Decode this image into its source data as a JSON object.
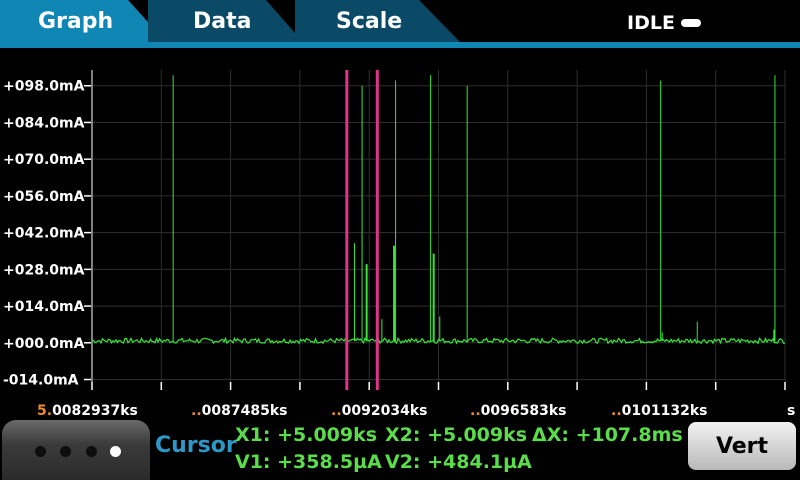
{
  "tabs": [
    {
      "label": "Graph",
      "active": true
    },
    {
      "label": "Data",
      "active": false
    },
    {
      "label": "Scale",
      "active": false
    }
  ],
  "status": {
    "label": "IDLE",
    "icon": "idle-indicator-icon"
  },
  "chart_data": {
    "type": "line",
    "y_unit": "mA",
    "y_ticks": [
      "+098.0mA",
      "+084.0mA",
      "+070.0mA",
      "+056.0mA",
      "+042.0mA",
      "+028.0mA",
      "+014.0mA",
      "+000.0mA",
      "-014.0mA"
    ],
    "y_tick_values": [
      98,
      84,
      70,
      56,
      42,
      28,
      14,
      0,
      -14
    ],
    "ylim": [
      -18,
      104
    ],
    "x_ticks": [
      {
        "prefix": "5.",
        "label": "0082937ks"
      },
      {
        "prefix": "..",
        "label": "0087485ks"
      },
      {
        "prefix": "..",
        "label": "0092034ks"
      },
      {
        "prefix": "..",
        "label": "0096583ks"
      },
      {
        "prefix": "..",
        "label": "0101132ks"
      }
    ],
    "x_unit": "s",
    "x_range_ks": [
      5.0082937,
      5.010568
    ],
    "series": [
      {
        "color": "#39e639",
        "baseline_mA": 0.6,
        "spikes": [
          {
            "x_ks": 5.00856,
            "y_mA": 102,
            "width": 1
          },
          {
            "x_ks": 5.009155,
            "y_mA": 38,
            "width": 1
          },
          {
            "x_ks": 5.00918,
            "y_mA": 98,
            "width": 1
          },
          {
            "x_ks": 5.009195,
            "y_mA": 30,
            "width": 2
          },
          {
            "x_ks": 5.009245,
            "y_mA": 9,
            "width": 1
          },
          {
            "x_ks": 5.009285,
            "y_mA": 37,
            "width": 2
          },
          {
            "x_ks": 5.00929,
            "y_mA": 100,
            "width": 1
          },
          {
            "x_ks": 5.009405,
            "y_mA": 102,
            "width": 1
          },
          {
            "x_ks": 5.009415,
            "y_mA": 34,
            "width": 2
          },
          {
            "x_ks": 5.009435,
            "y_mA": 10,
            "width": 1
          },
          {
            "x_ks": 5.009525,
            "y_mA": 98,
            "width": 1
          },
          {
            "x_ks": 5.01016,
            "y_mA": 100,
            "width": 1
          },
          {
            "x_ks": 5.010165,
            "y_mA": 4,
            "width": 1
          },
          {
            "x_ks": 5.01028,
            "y_mA": 8,
            "width": 1
          },
          {
            "x_ks": 5.010535,
            "y_mA": 102,
            "width": 1
          },
          {
            "x_ks": 5.010533,
            "y_mA": 5,
            "width": 2
          }
        ]
      }
    ],
    "cursors": [
      {
        "name": "X1",
        "x_ks": 5.00913,
        "color": "#e0338a"
      },
      {
        "name": "X2",
        "x_ks": 5.00923,
        "color": "#e0338a"
      }
    ],
    "grid": true
  },
  "cursor": {
    "title": "Cursor",
    "x1": "X1: +5.009ks",
    "x2": "X2: +5.009ks",
    "dx": "ΔX: +107.8ms",
    "v1": "V1: +358.5µA",
    "v2": "V2: +484.1µA"
  },
  "swipe": {
    "page_count": 4,
    "active_page": 4
  },
  "vert_button": {
    "label": "Vert"
  }
}
